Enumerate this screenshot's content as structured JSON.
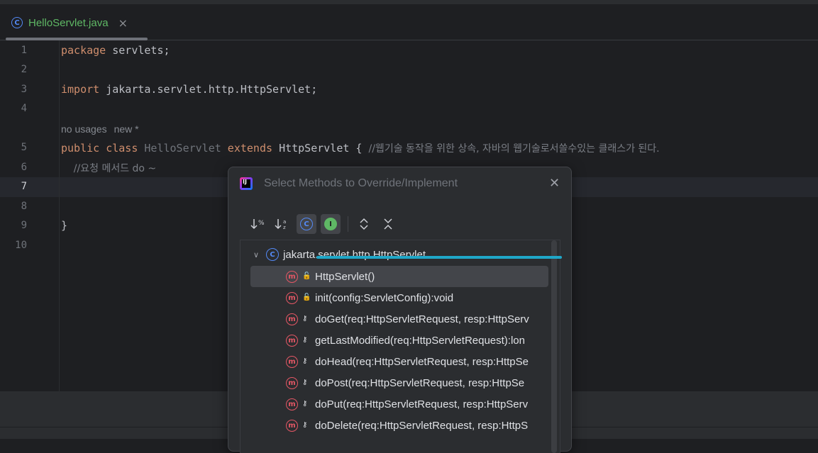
{
  "tab": {
    "icon": "class-icon",
    "label": "HelloServlet.java",
    "close": "×"
  },
  "editor": {
    "lines": [
      {
        "num": "1"
      },
      {
        "num": "2"
      },
      {
        "num": "3"
      },
      {
        "num": "4"
      },
      {
        "num": "5"
      },
      {
        "num": "6"
      },
      {
        "num": "7"
      },
      {
        "num": "8"
      },
      {
        "num": "9"
      },
      {
        "num": "10"
      }
    ],
    "code": {
      "l1_kw": "package",
      "l1_rest": " servlets;",
      "l3_kw": "import",
      "l3_rest": " jakarta.servlet.http.HttpServlet;",
      "hint_usages": "no usages",
      "hint_new": "new *",
      "l5_public": "public",
      "l5_class": " class ",
      "l5_name": "HelloServlet",
      "l5_extends": " extends ",
      "l5_parent": "HttpServlet { ",
      "l5_comment": "//웹기술 동작을 위한 상속, 자바의 웹기술로서쓸수있는 클래스가 된다.",
      "l6_comment": "    //요청 메서드 do ~",
      "l9_brace": "}"
    }
  },
  "dialog": {
    "title": "Select Methods to Override/Implement",
    "close": "✕",
    "toolbar": {
      "sort_visibility": "↓%",
      "sort_alpha": "↓a/z",
      "show_classes": "C",
      "show_interfaces": "I",
      "expand_all": "⌃⌄",
      "collapse_all": "⌄⌃"
    },
    "tree": {
      "root": "jakarta.servlet.http.HttpServlet",
      "methods": [
        {
          "label": "HttpServlet()",
          "visibility": "public"
        },
        {
          "label": "init(config:ServletConfig):void",
          "visibility": "public"
        },
        {
          "label": "doGet(req:HttpServletRequest, resp:HttpServ",
          "visibility": "protected"
        },
        {
          "label": "getLastModified(req:HttpServletRequest):lon",
          "visibility": "protected"
        },
        {
          "label": "doHead(req:HttpServletRequest, resp:HttpSe",
          "visibility": "protected"
        },
        {
          "label": "doPost(req:HttpServletRequest, resp:HttpSe",
          "visibility": "protected"
        },
        {
          "label": "doPut(req:HttpServletRequest, resp:HttpServ",
          "visibility": "protected"
        },
        {
          "label": "doDelete(req:HttpServletRequest, resp:HttpS",
          "visibility": "protected"
        }
      ]
    }
  },
  "colors": {
    "accent": "#548af7",
    "keyword": "#cf8e6d",
    "method_icon": "#e55765",
    "annotation": "#1fa7c8"
  }
}
